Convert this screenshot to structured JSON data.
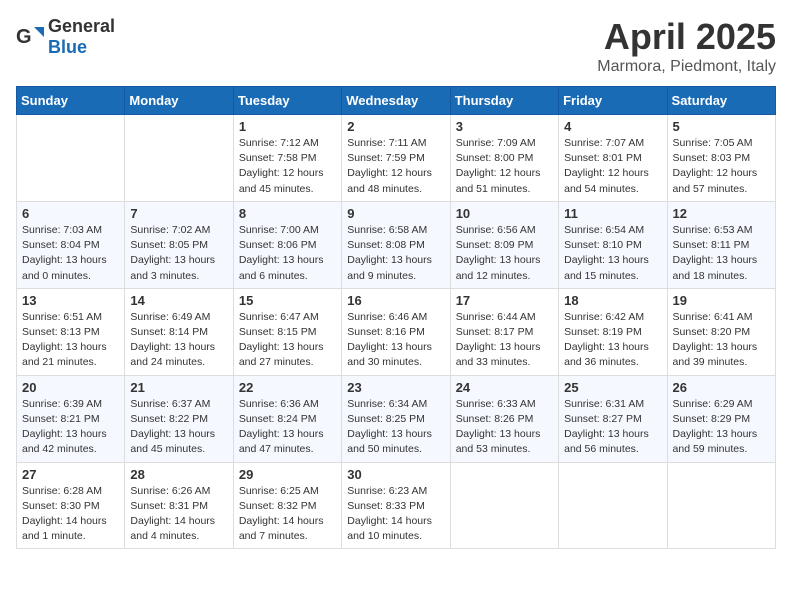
{
  "header": {
    "logo_general": "General",
    "logo_blue": "Blue",
    "month_title": "April 2025",
    "location": "Marmora, Piedmont, Italy"
  },
  "days_of_week": [
    "Sunday",
    "Monday",
    "Tuesday",
    "Wednesday",
    "Thursday",
    "Friday",
    "Saturday"
  ],
  "weeks": [
    [
      {
        "day": "",
        "info": ""
      },
      {
        "day": "",
        "info": ""
      },
      {
        "day": "1",
        "info": "Sunrise: 7:12 AM\nSunset: 7:58 PM\nDaylight: 12 hours and 45 minutes."
      },
      {
        "day": "2",
        "info": "Sunrise: 7:11 AM\nSunset: 7:59 PM\nDaylight: 12 hours and 48 minutes."
      },
      {
        "day": "3",
        "info": "Sunrise: 7:09 AM\nSunset: 8:00 PM\nDaylight: 12 hours and 51 minutes."
      },
      {
        "day": "4",
        "info": "Sunrise: 7:07 AM\nSunset: 8:01 PM\nDaylight: 12 hours and 54 minutes."
      },
      {
        "day": "5",
        "info": "Sunrise: 7:05 AM\nSunset: 8:03 PM\nDaylight: 12 hours and 57 minutes."
      }
    ],
    [
      {
        "day": "6",
        "info": "Sunrise: 7:03 AM\nSunset: 8:04 PM\nDaylight: 13 hours and 0 minutes."
      },
      {
        "day": "7",
        "info": "Sunrise: 7:02 AM\nSunset: 8:05 PM\nDaylight: 13 hours and 3 minutes."
      },
      {
        "day": "8",
        "info": "Sunrise: 7:00 AM\nSunset: 8:06 PM\nDaylight: 13 hours and 6 minutes."
      },
      {
        "day": "9",
        "info": "Sunrise: 6:58 AM\nSunset: 8:08 PM\nDaylight: 13 hours and 9 minutes."
      },
      {
        "day": "10",
        "info": "Sunrise: 6:56 AM\nSunset: 8:09 PM\nDaylight: 13 hours and 12 minutes."
      },
      {
        "day": "11",
        "info": "Sunrise: 6:54 AM\nSunset: 8:10 PM\nDaylight: 13 hours and 15 minutes."
      },
      {
        "day": "12",
        "info": "Sunrise: 6:53 AM\nSunset: 8:11 PM\nDaylight: 13 hours and 18 minutes."
      }
    ],
    [
      {
        "day": "13",
        "info": "Sunrise: 6:51 AM\nSunset: 8:13 PM\nDaylight: 13 hours and 21 minutes."
      },
      {
        "day": "14",
        "info": "Sunrise: 6:49 AM\nSunset: 8:14 PM\nDaylight: 13 hours and 24 minutes."
      },
      {
        "day": "15",
        "info": "Sunrise: 6:47 AM\nSunset: 8:15 PM\nDaylight: 13 hours and 27 minutes."
      },
      {
        "day": "16",
        "info": "Sunrise: 6:46 AM\nSunset: 8:16 PM\nDaylight: 13 hours and 30 minutes."
      },
      {
        "day": "17",
        "info": "Sunrise: 6:44 AM\nSunset: 8:17 PM\nDaylight: 13 hours and 33 minutes."
      },
      {
        "day": "18",
        "info": "Sunrise: 6:42 AM\nSunset: 8:19 PM\nDaylight: 13 hours and 36 minutes."
      },
      {
        "day": "19",
        "info": "Sunrise: 6:41 AM\nSunset: 8:20 PM\nDaylight: 13 hours and 39 minutes."
      }
    ],
    [
      {
        "day": "20",
        "info": "Sunrise: 6:39 AM\nSunset: 8:21 PM\nDaylight: 13 hours and 42 minutes."
      },
      {
        "day": "21",
        "info": "Sunrise: 6:37 AM\nSunset: 8:22 PM\nDaylight: 13 hours and 45 minutes."
      },
      {
        "day": "22",
        "info": "Sunrise: 6:36 AM\nSunset: 8:24 PM\nDaylight: 13 hours and 47 minutes."
      },
      {
        "day": "23",
        "info": "Sunrise: 6:34 AM\nSunset: 8:25 PM\nDaylight: 13 hours and 50 minutes."
      },
      {
        "day": "24",
        "info": "Sunrise: 6:33 AM\nSunset: 8:26 PM\nDaylight: 13 hours and 53 minutes."
      },
      {
        "day": "25",
        "info": "Sunrise: 6:31 AM\nSunset: 8:27 PM\nDaylight: 13 hours and 56 minutes."
      },
      {
        "day": "26",
        "info": "Sunrise: 6:29 AM\nSunset: 8:29 PM\nDaylight: 13 hours and 59 minutes."
      }
    ],
    [
      {
        "day": "27",
        "info": "Sunrise: 6:28 AM\nSunset: 8:30 PM\nDaylight: 14 hours and 1 minute."
      },
      {
        "day": "28",
        "info": "Sunrise: 6:26 AM\nSunset: 8:31 PM\nDaylight: 14 hours and 4 minutes."
      },
      {
        "day": "29",
        "info": "Sunrise: 6:25 AM\nSunset: 8:32 PM\nDaylight: 14 hours and 7 minutes."
      },
      {
        "day": "30",
        "info": "Sunrise: 6:23 AM\nSunset: 8:33 PM\nDaylight: 14 hours and 10 minutes."
      },
      {
        "day": "",
        "info": ""
      },
      {
        "day": "",
        "info": ""
      },
      {
        "day": "",
        "info": ""
      }
    ]
  ]
}
